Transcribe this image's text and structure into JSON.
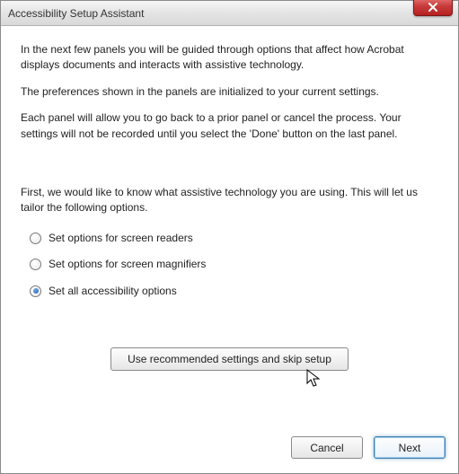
{
  "window": {
    "title": "Accessibility Setup Assistant"
  },
  "intro": {
    "p1": "In the next few panels you will be guided through options that affect how Acrobat displays documents and interacts with assistive technology.",
    "p2": "The preferences shown in the panels are initialized to your current settings.",
    "p3": "Each panel will allow you to go back to a prior panel or cancel the process. Your settings will not be recorded until you select the 'Done' button on the last panel."
  },
  "prompt": "First, we would like to know what assistive technology you are using. This will let us tailor the following options.",
  "options": {
    "screen_readers": "Set options for screen readers",
    "screen_magnifiers": "Set options for screen magnifiers",
    "set_all": "Set all accessibility options",
    "selected": "set_all"
  },
  "buttons": {
    "recommend": "Use recommended settings and skip setup",
    "cancel": "Cancel",
    "next": "Next"
  }
}
